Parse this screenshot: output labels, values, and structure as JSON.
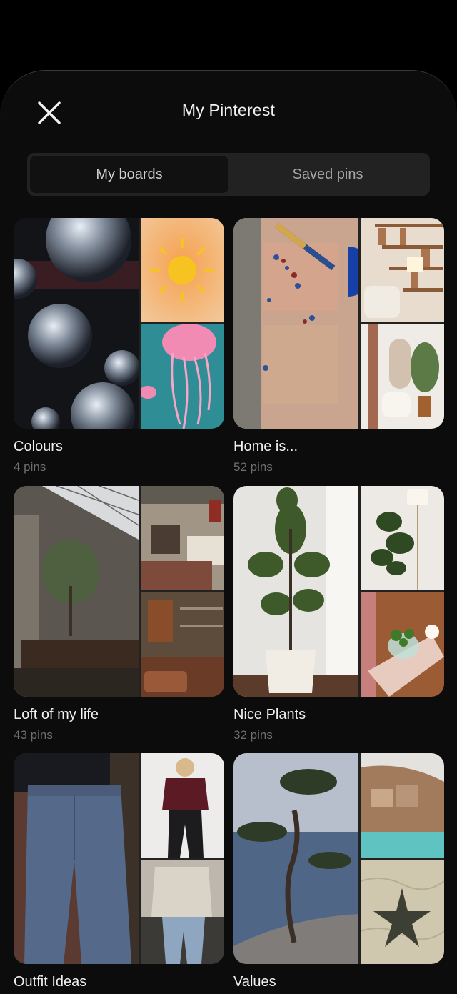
{
  "header": {
    "title": "My Pinterest",
    "close_icon": "close-icon"
  },
  "tabs": [
    {
      "label": "My boards",
      "active": true
    },
    {
      "label": "Saved pins",
      "active": false
    }
  ],
  "boards": [
    {
      "name": "Colours",
      "count": "4 pins"
    },
    {
      "name": "Home is...",
      "count": "52 pins"
    },
    {
      "name": "Loft of my life",
      "count": "43 pins"
    },
    {
      "name": "Nice Plants",
      "count": "32 pins"
    },
    {
      "name": "Outfit Ideas",
      "count": ""
    },
    {
      "name": "Values",
      "count": ""
    }
  ],
  "colors": {
    "background": "#000000",
    "sheet": "#0c0c0c",
    "tab_track": "#222222",
    "tab_active": "#111111",
    "text_primary": "#f0f0f0",
    "text_secondary": "#6f6f6f"
  }
}
